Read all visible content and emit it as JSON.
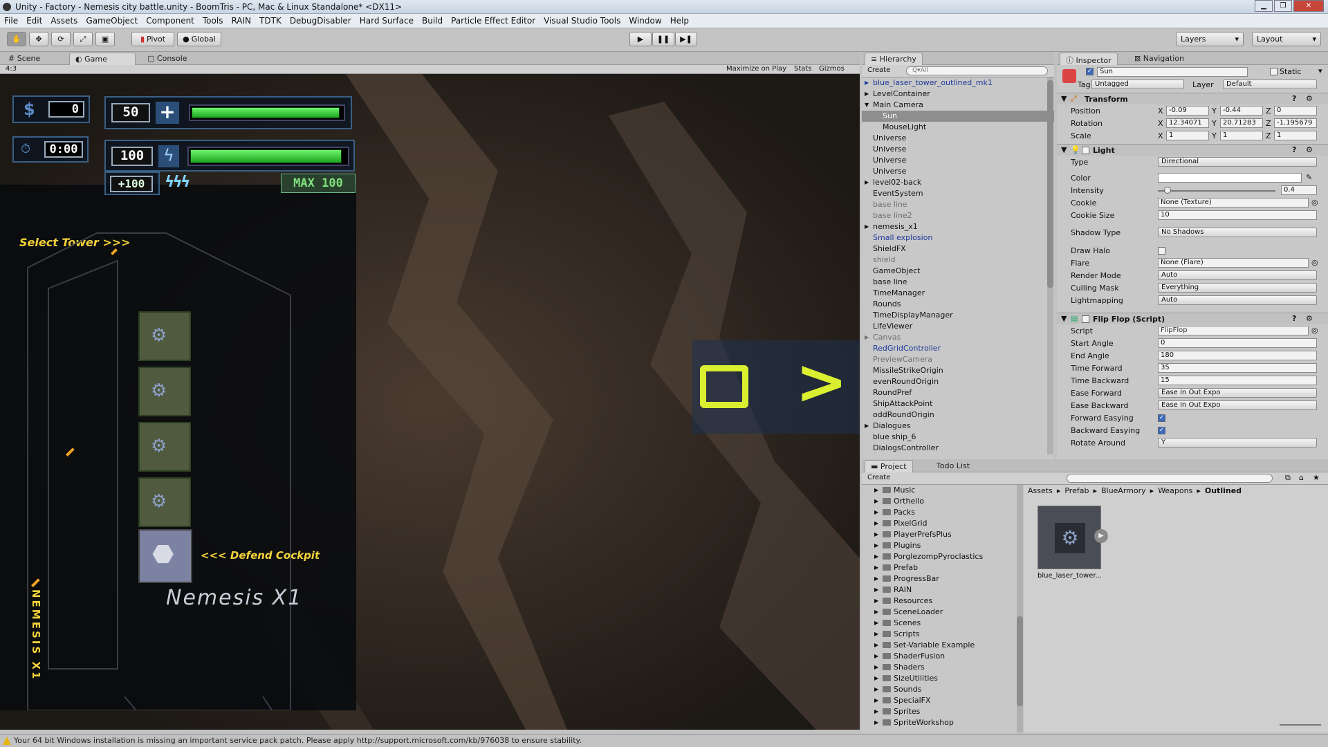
{
  "window": {
    "title": "Unity - Factory - Nemesis city battle.unity - BoomTris - PC, Mac & Linux Standalone* <DX11>"
  },
  "menu": [
    "File",
    "Edit",
    "Assets",
    "GameObject",
    "Component",
    "Tools",
    "RAIN",
    "TDTK",
    "DebugDisabler",
    "Hard Surface",
    "Build",
    "Particle Effect Editor",
    "Visual Studio Tools",
    "Window",
    "Help"
  ],
  "toolbar": {
    "pivot": "Pivot",
    "global": "Global",
    "layers": "Layers",
    "layout": "Layout"
  },
  "scene_tabs": {
    "scene": "Scene",
    "game": "Game",
    "console": "Console"
  },
  "game_bar": {
    "aspect": "4:3",
    "maximize": "Maximize on Play",
    "stats": "Stats",
    "gizmos": "Gizmos"
  },
  "game": {
    "money": "0",
    "time": "0:00",
    "shield_value": "50",
    "energy_value": "100",
    "energy_bonus": "+100",
    "max_label": "MAX 100",
    "shield_level": 0.98,
    "energy_level": 0.97,
    "select_tower": "Select Tower >>>",
    "defend_cockpit": "<<< Defend Cockpit",
    "ship_name": "Nemesis X1",
    "vertical_name": "NEMESIS X1"
  },
  "hierarchy": {
    "tab": "Hierarchy",
    "create": "Create",
    "search_placeholder": "Q▾All",
    "items": [
      {
        "label": "blue_laser_tower_outlined_mk1",
        "style": "blue",
        "indent": 0,
        "arrow": "▶"
      },
      {
        "label": "LevelContainer",
        "style": "",
        "indent": 0,
        "arrow": "▶"
      },
      {
        "label": "Main Camera",
        "style": "",
        "indent": 0,
        "arrow": "▼"
      },
      {
        "label": "Sun",
        "style": "sel",
        "indent": 1,
        "arrow": ""
      },
      {
        "label": "MouseLight",
        "style": "",
        "indent": 1,
        "arrow": ""
      },
      {
        "label": "Universe",
        "style": "",
        "indent": 0,
        "arrow": ""
      },
      {
        "label": "Universe",
        "style": "",
        "indent": 0,
        "arrow": ""
      },
      {
        "label": "Universe",
        "style": "",
        "indent": 0,
        "arrow": ""
      },
      {
        "label": "Universe",
        "style": "",
        "indent": 0,
        "arrow": ""
      },
      {
        "label": "level02-back",
        "style": "",
        "indent": 0,
        "arrow": "▶"
      },
      {
        "label": "EventSystem",
        "style": "",
        "indent": 0,
        "arrow": ""
      },
      {
        "label": "base line",
        "style": "grey",
        "indent": 0,
        "arrow": ""
      },
      {
        "label": "base line2",
        "style": "grey",
        "indent": 0,
        "arrow": ""
      },
      {
        "label": "nemesis_x1",
        "style": "",
        "indent": 0,
        "arrow": "▶"
      },
      {
        "label": "Small explosion",
        "style": "blue",
        "indent": 0,
        "arrow": ""
      },
      {
        "label": "ShieldFX",
        "style": "",
        "indent": 0,
        "arrow": ""
      },
      {
        "label": "shield",
        "style": "grey",
        "indent": 0,
        "arrow": ""
      },
      {
        "label": "GameObject",
        "style": "",
        "indent": 0,
        "arrow": ""
      },
      {
        "label": "base line",
        "style": "",
        "indent": 0,
        "arrow": ""
      },
      {
        "label": "TimeManager",
        "style": "",
        "indent": 0,
        "arrow": ""
      },
      {
        "label": "Rounds",
        "style": "",
        "indent": 0,
        "arrow": ""
      },
      {
        "label": "TimeDisplayManager",
        "style": "",
        "indent": 0,
        "arrow": ""
      },
      {
        "label": "LifeViewer",
        "style": "",
        "indent": 0,
        "arrow": ""
      },
      {
        "label": "Canvas",
        "style": "grey",
        "indent": 0,
        "arrow": "▶"
      },
      {
        "label": "RedGridController",
        "style": "blue",
        "indent": 0,
        "arrow": ""
      },
      {
        "label": "PreviewCamera",
        "style": "grey",
        "indent": 0,
        "arrow": ""
      },
      {
        "label": "MissileStrikeOrigin",
        "style": "",
        "indent": 0,
        "arrow": ""
      },
      {
        "label": "evenRoundOrigin",
        "style": "",
        "indent": 0,
        "arrow": ""
      },
      {
        "label": "RoundPref",
        "style": "",
        "indent": 0,
        "arrow": ""
      },
      {
        "label": "ShipAttackPoint",
        "style": "",
        "indent": 0,
        "arrow": ""
      },
      {
        "label": "oddRoundOrigin",
        "style": "",
        "indent": 0,
        "arrow": ""
      },
      {
        "label": "Dialogues",
        "style": "",
        "indent": 0,
        "arrow": "▶"
      },
      {
        "label": "blue ship_6",
        "style": "",
        "indent": 0,
        "arrow": ""
      },
      {
        "label": "DialogsController",
        "style": "",
        "indent": 0,
        "arrow": ""
      }
    ]
  },
  "inspector": {
    "tab": "Inspector",
    "nav_tab": "Navigation",
    "object_name": "Sun",
    "static_label": "Static",
    "tag_label": "Tag",
    "tag_value": "Untagged",
    "layer_label": "Layer",
    "layer_value": "Default",
    "transform": {
      "title": "Transform",
      "position": {
        "label": "Position",
        "x": "-0.09",
        "y": "-0.44",
        "z": "0"
      },
      "rotation": {
        "label": "Rotation",
        "x": "12.34071",
        "y": "20.71283",
        "z": "-1.195679"
      },
      "scale": {
        "label": "Scale",
        "x": "1",
        "y": "1",
        "z": "1"
      }
    },
    "light": {
      "title": "Light",
      "type_label": "Type",
      "type_value": "Directional",
      "color_label": "Color",
      "intensity_label": "Intensity",
      "intensity_value": "0.4",
      "intensity_level": 0.05,
      "cookie_label": "Cookie",
      "cookie_value": "None (Texture)",
      "cookie_size_label": "Cookie Size",
      "cookie_size_value": "10",
      "shadow_label": "Shadow Type",
      "shadow_value": "No Shadows",
      "halo_label": "Draw Halo",
      "flare_label": "Flare",
      "flare_value": "None (Flare)",
      "render_label": "Render Mode",
      "render_value": "Auto",
      "culling_label": "Culling Mask",
      "culling_value": "Everything",
      "lightmap_label": "Lightmapping",
      "lightmap_value": "Auto"
    },
    "flipflop": {
      "title": "Flip Flop (Script)",
      "script_label": "Script",
      "script_value": "FlipFlop",
      "start_label": "Start Angle",
      "start_value": "0",
      "end_label": "End Angle",
      "end_value": "180",
      "tf_label": "Time Forward",
      "tf_value": "35",
      "tb_label": "Time Backward",
      "tb_value": "15",
      "ef_label": "Ease Forward",
      "ef_value": "Ease In Out Expo",
      "eb_label": "Ease Backward",
      "eb_value": "Ease In Out Expo",
      "fe_label": "Forward Easying",
      "be_label": "Backward Easying",
      "ra_label": "Rotate Around",
      "ra_value": "Y"
    }
  },
  "project": {
    "tab": "Project",
    "todo_tab": "Todo List",
    "create": "Create",
    "breadcrumb": [
      "Assets",
      "Prefab",
      "BlueArmory",
      "Weapons",
      "Outlined"
    ],
    "folders": [
      "Music",
      "Orthello",
      "Packs",
      "PixelGrid",
      "PlayerPrefsPlus",
      "Plugins",
      "PorglezompPyroclastics",
      "Prefab",
      "ProgressBar",
      "RAIN",
      "Resources",
      "SceneLoader",
      "Scenes",
      "Scripts",
      "Set-Variable Example",
      "ShaderFusion",
      "Shaders",
      "SizeUtilities",
      "Sounds",
      "SpecialFX",
      "Sprites",
      "SpriteWorkshop"
    ],
    "asset_name": "blue_laser_tower..."
  },
  "status": {
    "message": "Your 64 bit Windows installation is missing an important service pack patch. Please apply http://support.microsoft.com/kb/976038 to ensure stability."
  }
}
